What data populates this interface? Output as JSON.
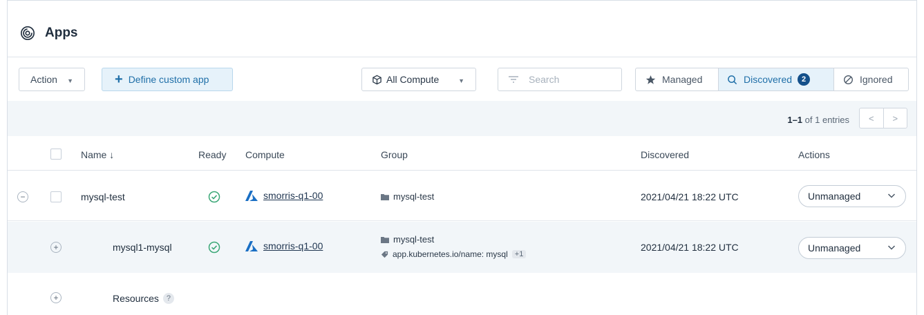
{
  "header": {
    "title": "Apps",
    "icon": "apps-swirl-icon"
  },
  "toolbar": {
    "action_label": "Action",
    "define_label": "Define custom app",
    "compute_label": "All Compute",
    "search_placeholder": "Search",
    "segments": {
      "managed": "Managed",
      "discovered": "Discovered",
      "discovered_count": "2",
      "ignored": "Ignored"
    }
  },
  "pager": {
    "range": "1–1",
    "of_text": "of 1 entries"
  },
  "table": {
    "headers": {
      "name": "Name ↓",
      "ready": "Ready",
      "compute": "Compute",
      "group": "Group",
      "discovered": "Discovered",
      "actions": "Actions"
    },
    "rows": [
      {
        "name": "mysql-test",
        "compute": "smorris-q1-00",
        "group": "mysql-test",
        "discovered": "2021/04/21 18:22 UTC",
        "action": "Unmanaged"
      },
      {
        "name": "mysql1-mysql",
        "compute": "smorris-q1-00",
        "group": "mysql-test",
        "label": "app.kubernetes.io/name: mysql",
        "extra": "+1",
        "discovered": "2021/04/21 18:22 UTC",
        "action": "Unmanaged"
      }
    ],
    "resources": {
      "label": "Resources",
      "help": "?"
    }
  },
  "colors": {
    "accent": "#1f6fa8",
    "badge": "#14508a",
    "ready": "#3aa776",
    "azure": "#1a6fc4",
    "band": "#f2f6f9"
  }
}
